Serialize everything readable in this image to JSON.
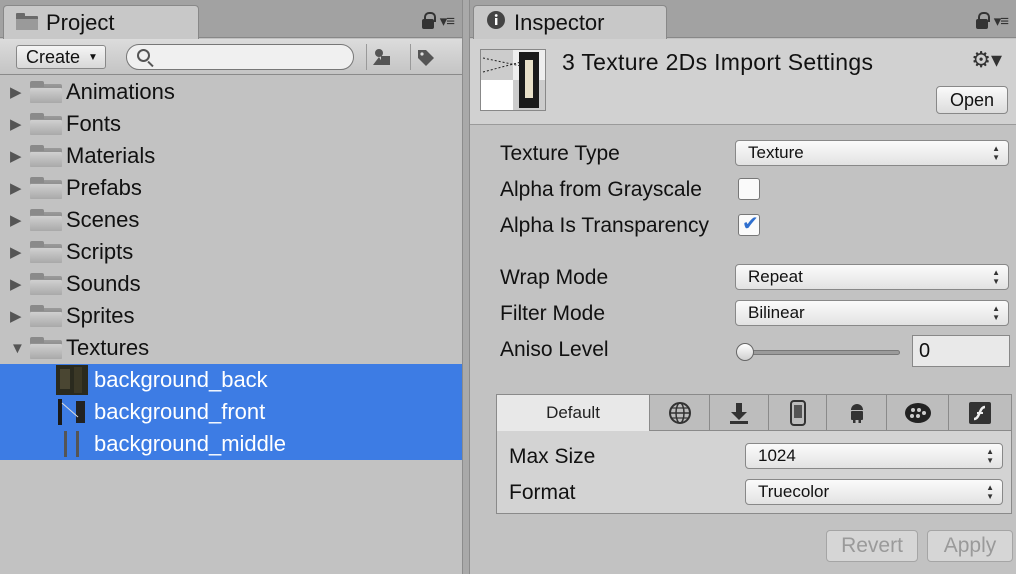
{
  "project": {
    "tab_title": "Project",
    "create_label": "Create",
    "search_placeholder": "",
    "tree": [
      {
        "label": "Animations",
        "type": "folder",
        "expanded": false
      },
      {
        "label": "Fonts",
        "type": "folder",
        "expanded": false
      },
      {
        "label": "Materials",
        "type": "folder",
        "expanded": false
      },
      {
        "label": "Prefabs",
        "type": "folder",
        "expanded": false
      },
      {
        "label": "Scenes",
        "type": "folder",
        "expanded": false
      },
      {
        "label": "Scripts",
        "type": "folder",
        "expanded": false
      },
      {
        "label": "Sounds",
        "type": "folder",
        "expanded": false
      },
      {
        "label": "Sprites",
        "type": "folder",
        "expanded": false
      },
      {
        "label": "Textures",
        "type": "folder",
        "expanded": true
      },
      {
        "label": "background_back",
        "type": "texture",
        "selected": true
      },
      {
        "label": "background_front",
        "type": "texture",
        "selected": true
      },
      {
        "label": "background_middle",
        "type": "texture",
        "selected": true
      }
    ]
  },
  "inspector": {
    "tab_title": "Inspector",
    "header_title": "3 Texture 2Ds Import Settings",
    "open_label": "Open",
    "texture_type_label": "Texture Type",
    "texture_type_value": "Texture",
    "alpha_gray_label": "Alpha from Grayscale",
    "alpha_gray_checked": false,
    "alpha_transp_label": "Alpha Is Transparency",
    "alpha_transp_checked": true,
    "wrap_label": "Wrap Mode",
    "wrap_value": "Repeat",
    "filter_label": "Filter Mode",
    "filter_value": "Bilinear",
    "aniso_label": "Aniso Level",
    "aniso_value": "0",
    "platform_tabs": [
      {
        "label": "Default",
        "icon": "default-label"
      },
      {
        "label": "",
        "icon": "globe-icon"
      },
      {
        "label": "",
        "icon": "download-icon"
      },
      {
        "label": "",
        "icon": "phone-icon"
      },
      {
        "label": "",
        "icon": "android-icon"
      },
      {
        "label": "",
        "icon": "blackberry-icon"
      },
      {
        "label": "",
        "icon": "flash-icon"
      }
    ],
    "max_size_label": "Max Size",
    "max_size_value": "1024",
    "format_label": "Format",
    "format_value": "Truecolor",
    "revert_label": "Revert",
    "apply_label": "Apply"
  },
  "colors": {
    "selection": "#3d7ce4",
    "panel_bg": "#c2c2c2",
    "checkbox_check": "#2f6fce"
  }
}
